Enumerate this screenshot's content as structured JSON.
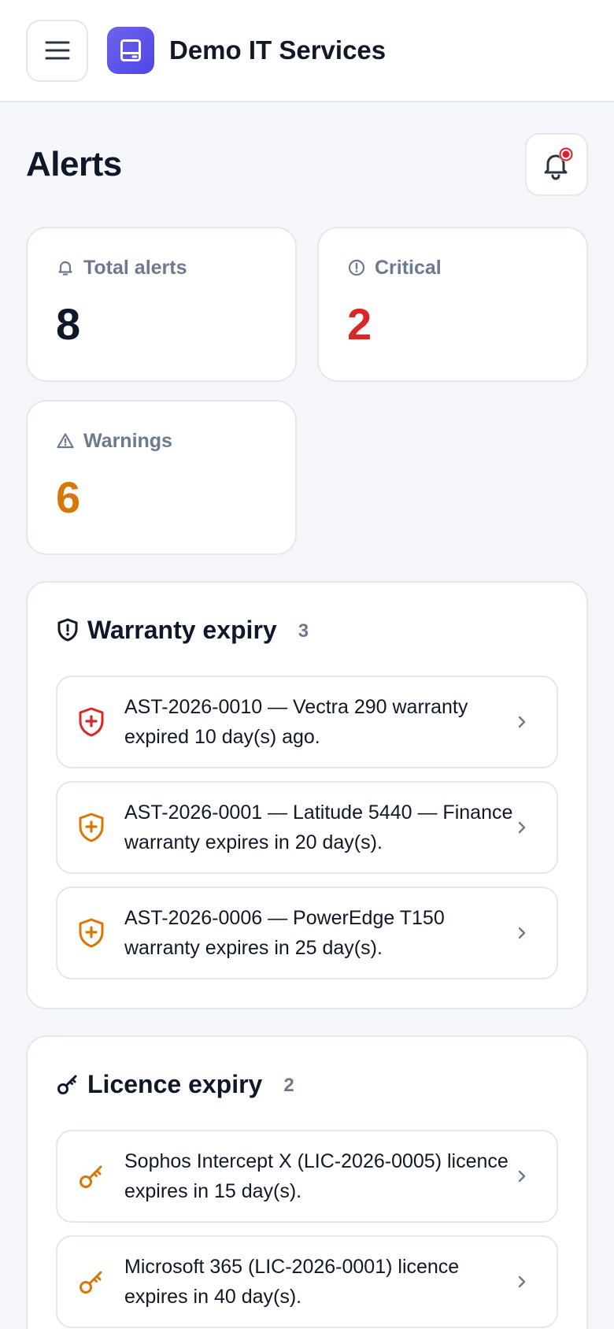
{
  "header": {
    "menu_icon": "hamburger-icon",
    "logo_icon": "hard-drive-icon",
    "org_name": "Demo IT Services"
  },
  "page": {
    "title": "Alerts",
    "notification_icon": "bell-icon",
    "notification_dot_color": "#e11d2e"
  },
  "stats": {
    "total": {
      "label": "Total alerts",
      "value": "8",
      "icon": "bell-icon",
      "color": "#0f172a"
    },
    "critical": {
      "label": "Critical",
      "value": "2",
      "icon": "alert-circle-icon",
      "color": "#dc2626"
    },
    "warnings": {
      "label": "Warnings",
      "value": "6",
      "icon": "warning-triangle-icon",
      "color": "#d97706"
    }
  },
  "warranty": {
    "title": "Warranty expiry",
    "count": "3",
    "icon": "shield-icon",
    "items": [
      {
        "text": "AST-2026-0010 — Vectra 290 warranty expired 10 day(s) ago.",
        "severity": "critical",
        "color": "#dc2626"
      },
      {
        "text": "AST-2026-0001 — Latitude 5440 — Finance warranty expires in 20 day(s).",
        "severity": "warning",
        "color": "#d97706"
      },
      {
        "text": "AST-2026-0006 — PowerEdge T150 warranty expires in 25 day(s).",
        "severity": "warning",
        "color": "#d97706"
      }
    ]
  },
  "licence": {
    "title": "Licence expiry",
    "count": "2",
    "icon": "key-icon",
    "items": [
      {
        "text": "Sophos Intercept X (LIC-2026-0005) licence expires in 15 day(s).",
        "severity": "warning",
        "color": "#d97706"
      },
      {
        "text": "Microsoft 365 (LIC-2026-0001) licence expires in 40 day(s).",
        "severity": "warning",
        "color": "#d97706"
      }
    ]
  }
}
